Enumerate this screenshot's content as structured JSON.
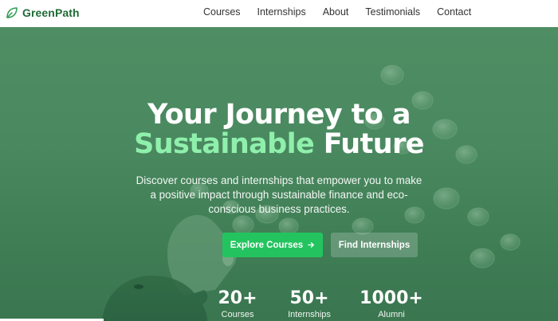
{
  "brand": {
    "name": "GreenPath",
    "icon": "leaf-icon"
  },
  "nav": {
    "links": [
      "Courses",
      "Internships",
      "About",
      "Testimonials",
      "Contact"
    ]
  },
  "hero": {
    "title_line1": "Your Journey to a",
    "title_accent": "Sustainable",
    "title_rest": "Future",
    "subtitle": "Discover courses and internships that empower you to make a positive impact through sustainable finance and eco-conscious business practices.",
    "primary_button": "Explore Courses",
    "primary_button_icon": "arrow-right-icon",
    "secondary_button": "Find Internships"
  },
  "stats": [
    {
      "value": "20+",
      "label": "Courses"
    },
    {
      "value": "50+",
      "label": "Internships"
    },
    {
      "value": "1000+",
      "label": "Alumni"
    }
  ],
  "colors": {
    "brand": "#1f6b35",
    "accent_text": "#8ff0ac",
    "primary_button": "#23c45f",
    "hero_overlay": "#4a8960"
  }
}
